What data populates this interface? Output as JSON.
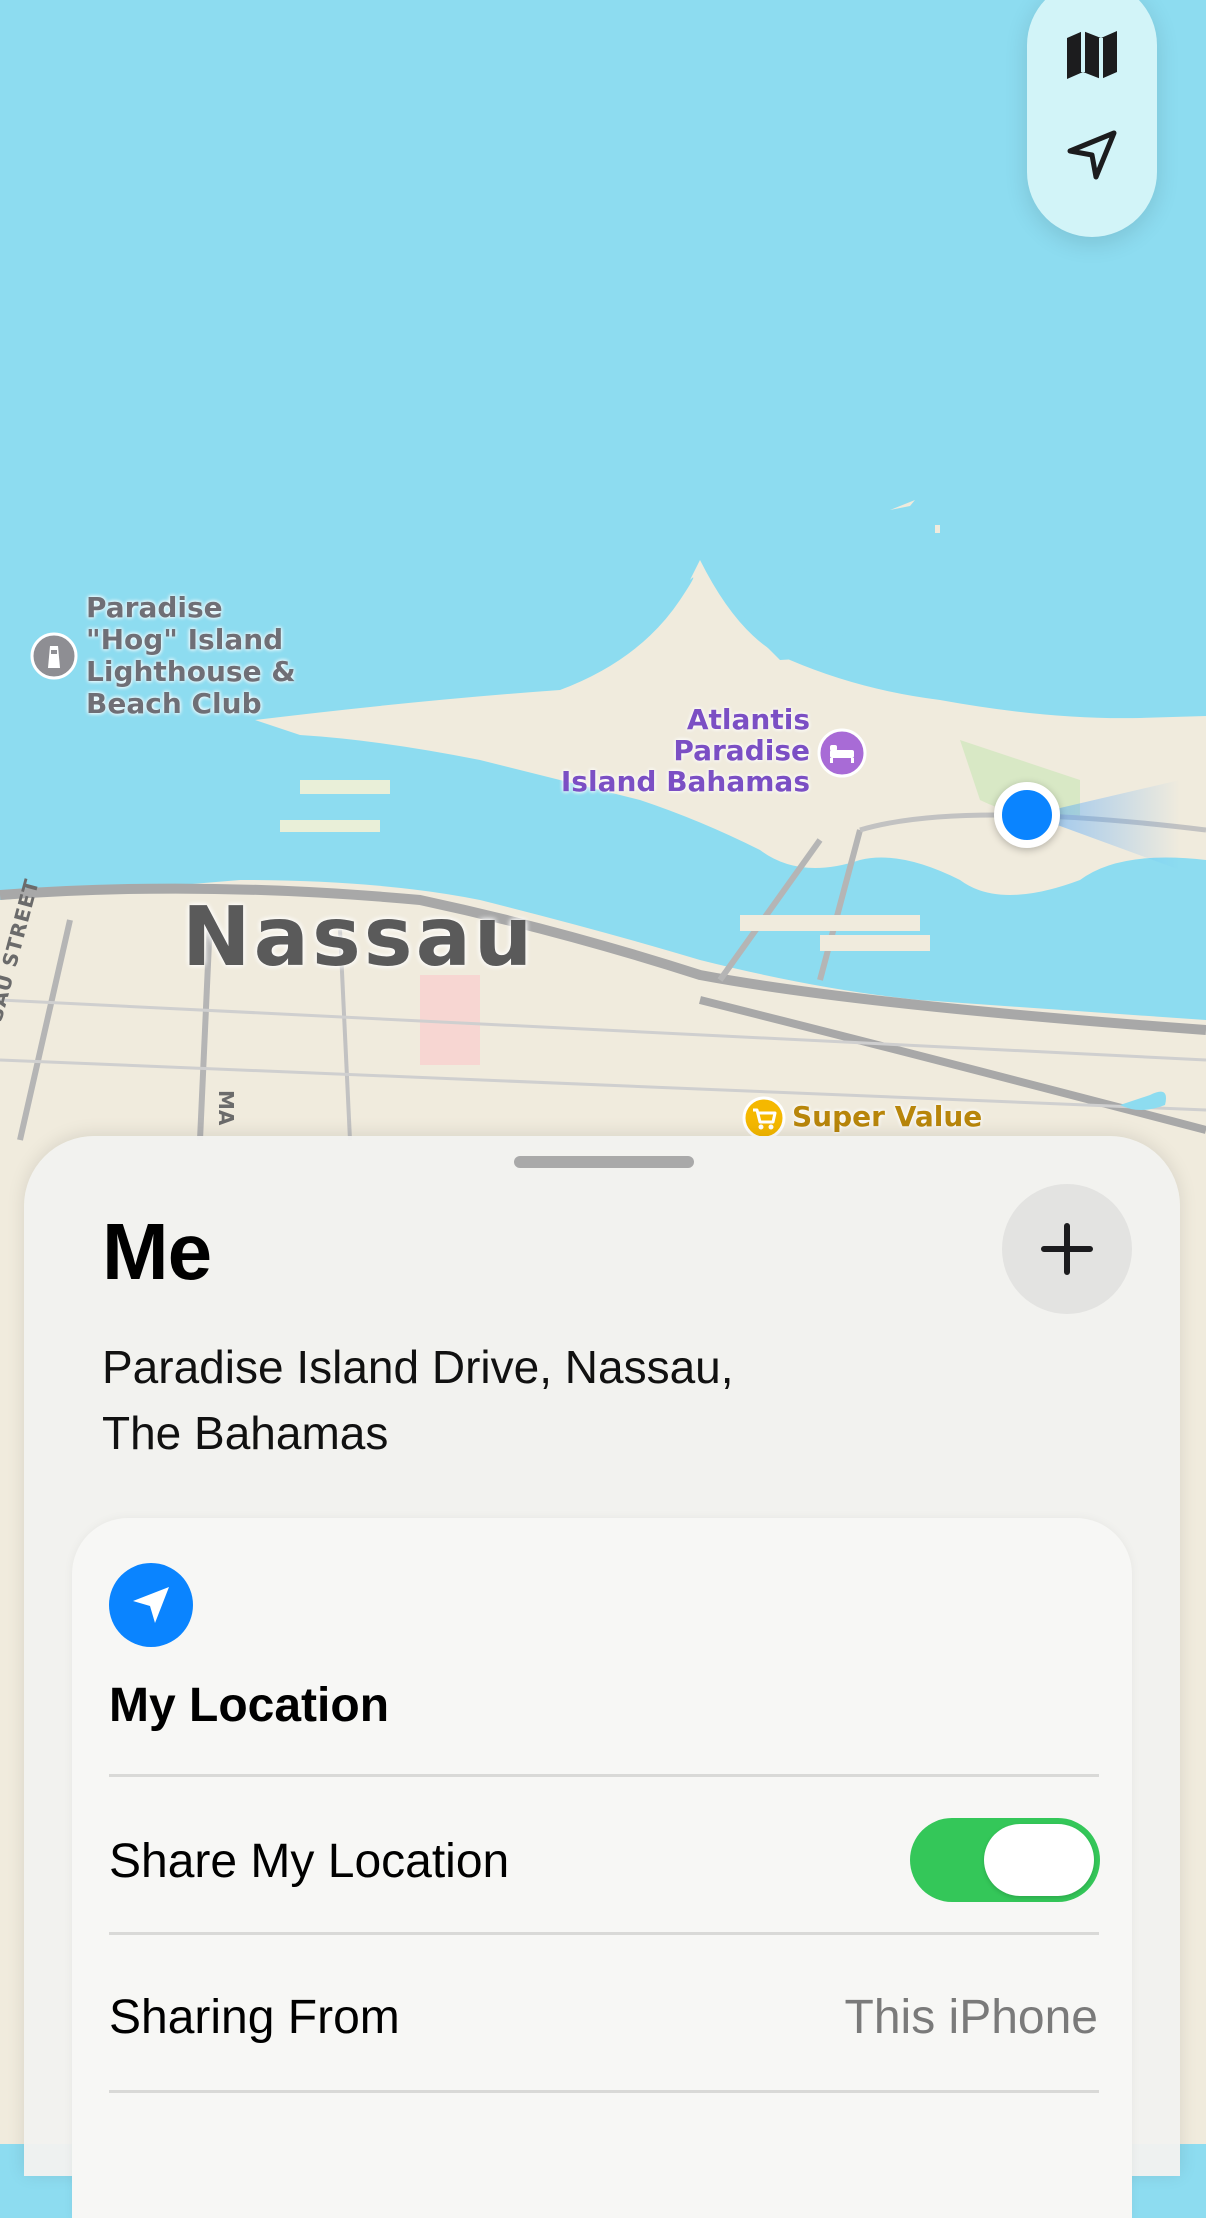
{
  "map": {
    "poi_lighthouse": {
      "lines": [
        "Paradise",
        "\"Hog\" Island",
        "Lighthouse &",
        "Beach Club"
      ],
      "icon": "lighthouse-icon"
    },
    "poi_atlantis": {
      "lines": [
        "Atlantis",
        "Paradise",
        "Island Bahamas"
      ],
      "icon": "bed-icon"
    },
    "city_label": "Nassau",
    "poi_supervalue": {
      "label": "Super Value",
      "icon": "shopping-cart-icon"
    },
    "street_nassau": "NASSAU STREET",
    "street_ma": "MA"
  },
  "controls": {
    "map_mode_icon": "map-icon",
    "locate_icon": "location-arrow-icon"
  },
  "sheet": {
    "title": "Me",
    "add_icon": "plus-icon",
    "address_line1": "Paradise Island Drive, Nassau,",
    "address_line2": "The Bahamas",
    "card": {
      "icon": "location-arrow-icon",
      "title": "My Location",
      "share_label": "Share My Location",
      "share_enabled": true,
      "sharing_from_label": "Sharing From",
      "sharing_from_value": "This iPhone"
    }
  },
  "colors": {
    "water": "#8ddcf0",
    "land": "#f0ebdd",
    "accent_blue": "#0a84ff",
    "toggle_green": "#34c759"
  }
}
